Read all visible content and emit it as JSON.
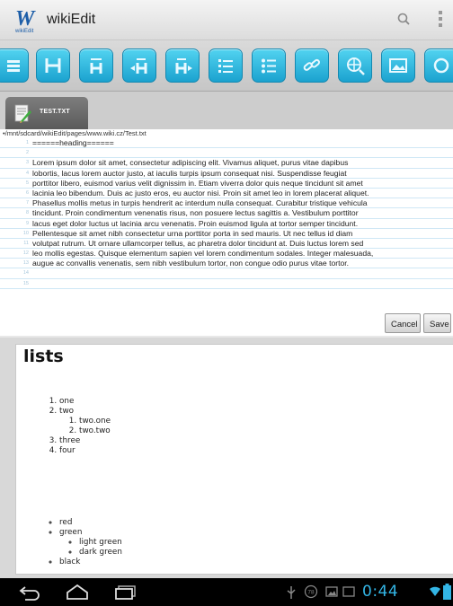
{
  "app": {
    "title": "wikiEdit",
    "logo_letter": "W",
    "logo_sub": "wikiEdit"
  },
  "toolbar": {
    "buttons": [
      "menu-icon",
      "heading-icon",
      "heading-icon",
      "heading-decrease-icon",
      "heading-increase-icon",
      "numbered-list-icon",
      "bullet-list-icon",
      "link-icon",
      "globe-link-icon",
      "image-icon",
      "more-icon"
    ]
  },
  "tab": {
    "label": "TEST.TXT"
  },
  "editor": {
    "path": "•/mnt/sdcard/wikiEdit/pages/www.wiki.cz/Test.txt",
    "lines": [
      {
        "n": "1",
        "text": "======heading======"
      },
      {
        "n": "2",
        "text": ""
      },
      {
        "n": "3",
        "text": "Lorem ipsum dolor sit amet, consectetur adipiscing elit. Vivamus aliquet, purus vitae dapibus"
      },
      {
        "n": "4",
        "text": "lobortis, lacus lorem auctor justo, at iaculis turpis ipsum consequat nisi. Suspendisse feugiat"
      },
      {
        "n": "5",
        "text": "porttitor libero, euismod varius velit dignissim in. Etiam viverra dolor quis neque tincidunt sit amet"
      },
      {
        "n": "6",
        "text": "lacinia leo bibendum. Duis ac justo eros, eu auctor nisi. Proin sit amet leo in lorem placerat aliquet."
      },
      {
        "n": "7",
        "text": "Phasellus mollis metus in turpis hendrerit ac interdum nulla consequat. Curabitur tristique vehicula"
      },
      {
        "n": "8",
        "text": "tincidunt. Proin condimentum venenatis risus, non posuere lectus sagittis a. Vestibulum porttitor"
      },
      {
        "n": "9",
        "text": "lacus eget dolor luctus ut lacinia arcu venenatis. Proin euismod ligula at tortor semper tincidunt."
      },
      {
        "n": "10",
        "text": "Pellentesque sit amet nibh consectetur urna porttitor porta in sed mauris. Ut nec tellus id diam"
      },
      {
        "n": "11",
        "text": "volutpat rutrum. Ut ornare ullamcorper tellus, ac pharetra dolor tincidunt at. Duis luctus lorem sed"
      },
      {
        "n": "12",
        "text": "leo mollis egestas. Quisque elementum sapien vel lorem condimentum sodales. Integer malesuada,"
      },
      {
        "n": "13",
        "text": "augue ac convallis venenatis, sem nibh vestibulum tortor, non congue odio purus vitae tortor."
      },
      {
        "n": "14",
        "text": ""
      },
      {
        "n": "15",
        "text": ""
      }
    ],
    "cancel_label": "Cancel",
    "save_label": "Save"
  },
  "preview": {
    "heading": "lists",
    "ordered": {
      "items": [
        "one",
        "two",
        "three",
        "four"
      ],
      "sub_items": [
        "two.one",
        "two.two"
      ]
    },
    "unordered": {
      "items": [
        "red",
        "green",
        "black"
      ],
      "sub_items": [
        "light green",
        "dark green"
      ]
    }
  },
  "statusbar": {
    "clock": "0:44",
    "icons": [
      "usb-icon",
      "notification-count-icon",
      "image-notification-icon",
      "wifi-icon",
      "battery-icon"
    ],
    "notification_count": "78"
  },
  "colors": {
    "accent": "#33b5e5",
    "toolbar_button": "#1ba2cf"
  }
}
